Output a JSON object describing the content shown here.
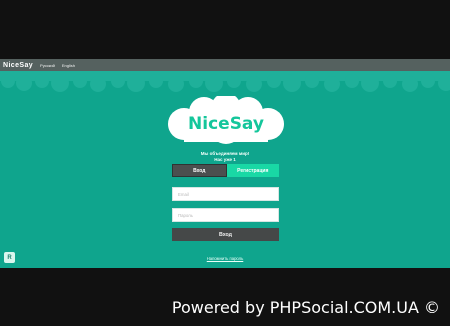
{
  "app": {
    "brand": "NiceSay",
    "languages": [
      "Русский",
      "English"
    ],
    "logo_text": "NiceSay",
    "tagline_line1": "Мы объединяем мир!",
    "tagline_line2": "Нас уже 1",
    "tabs": {
      "login": "Вход",
      "register": "Регистрация"
    },
    "form": {
      "email_placeholder": "Email",
      "password_placeholder": "Пароль",
      "submit_label": "Вход"
    },
    "recover_link": "Напомнить пароль",
    "corner_button_symbol": "R"
  },
  "footer": {
    "powered_text": "Powered by PHPSocial.COM.UA ©"
  },
  "colors": {
    "page_bg": "#111111",
    "app_bg": "#0fa58d",
    "topbar_bg": "#55615f",
    "tab_active": "#4b4f4f",
    "tab_inactive": "#19d8a5",
    "button": "#454848"
  }
}
